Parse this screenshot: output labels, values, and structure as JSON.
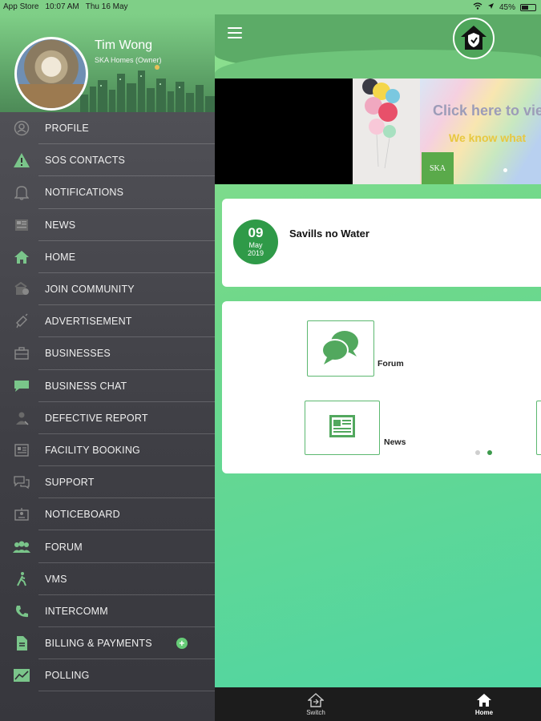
{
  "status_bar": {
    "carrier": "App Store",
    "time": "10:07 AM",
    "date": "Thu 16 May",
    "battery": "45%"
  },
  "drawer": {
    "user": {
      "name": "Tim Wong",
      "subtitle": "SKA Homes (Owner)"
    },
    "menu_items": [
      {
        "label": "PROFILE",
        "icon": "profile-icon"
      },
      {
        "label": "SOS CONTACTS",
        "icon": "warning-icon"
      },
      {
        "label": "NOTIFICATIONS",
        "icon": "bell-icon"
      },
      {
        "label": "NEWS",
        "icon": "news-icon"
      },
      {
        "label": "HOME",
        "icon": "home-icon"
      },
      {
        "label": "JOIN COMMUNITY",
        "icon": "community-icon"
      },
      {
        "label": "ADVERTISEMENT",
        "icon": "megaphone-icon"
      },
      {
        "label": "BUSINESSES",
        "icon": "briefcase-icon"
      },
      {
        "label": "BUSINESS CHAT",
        "icon": "chat-icon"
      },
      {
        "label": "DEFECTIVE REPORT",
        "icon": "report-icon"
      },
      {
        "label": "FACILITY BOOKING",
        "icon": "booking-icon"
      },
      {
        "label": "SUPPORT",
        "icon": "support-icon"
      },
      {
        "label": "NOTICEBOARD",
        "icon": "noticeboard-icon"
      },
      {
        "label": "FORUM",
        "icon": "forum-icon"
      },
      {
        "label": "VMS",
        "icon": "walker-icon"
      },
      {
        "label": "INTERCOMM",
        "icon": "phone-icon"
      },
      {
        "label": "BILLING & PAYMENTS",
        "icon": "document-icon"
      },
      {
        "label": "POLLING",
        "icon": "chart-icon"
      }
    ],
    "billing_plus": "+"
  },
  "banner": {
    "headline": "Click here to vie",
    "tagline": "We know what",
    "badge": "SKA"
  },
  "news_card": {
    "day": "09",
    "month": "May",
    "year": "2019",
    "title": "Savills no Water"
  },
  "features": {
    "forum_label": "Forum",
    "news_label": "News"
  },
  "tab_bar": {
    "switch_label": "Switch",
    "home_label": "Home"
  },
  "colors": {
    "accent_green": "#2f9a48",
    "header_green": "#5cab67",
    "drawer_bg": "#3f3f45"
  }
}
